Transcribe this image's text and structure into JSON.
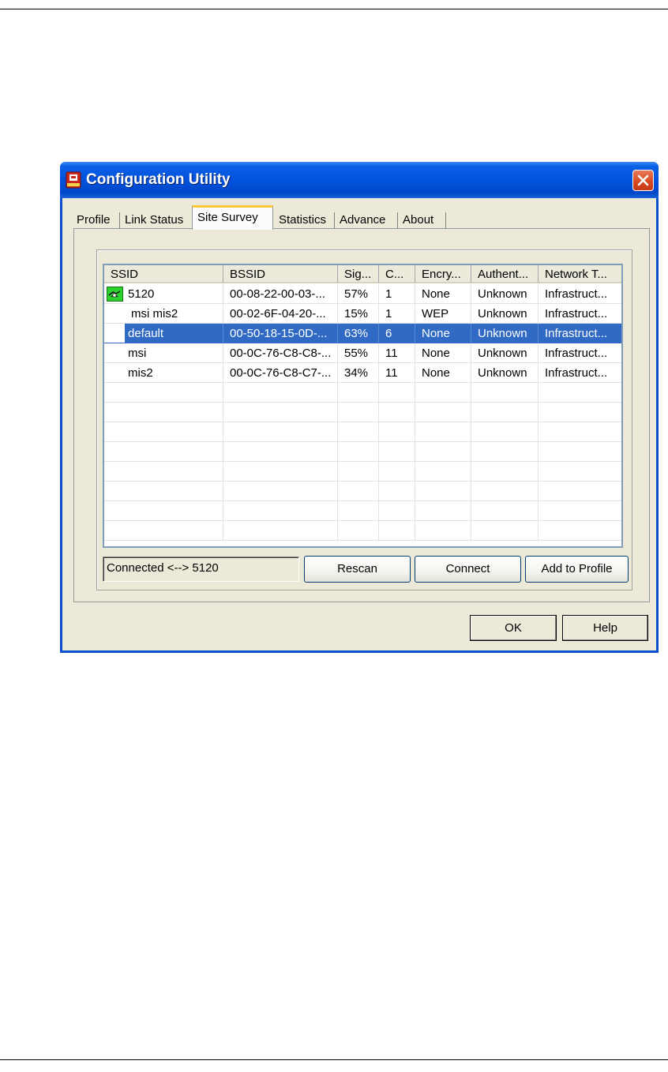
{
  "window": {
    "title": "Configuration Utility"
  },
  "tabs": [
    {
      "label": "Profile"
    },
    {
      "label": "Link Status"
    },
    {
      "label": "Site Survey"
    },
    {
      "label": "Statistics"
    },
    {
      "label": "Advance"
    },
    {
      "label": "About"
    }
  ],
  "active_tab": "Site Survey",
  "site_survey": {
    "columns": [
      "SSID",
      "BSSID",
      "Sig...",
      "C...",
      "Encry...",
      "Authent...",
      "Network T..."
    ],
    "rows": [
      {
        "ssid": "5120",
        "bssid": "00-08-22-00-03-...",
        "signal": "57%",
        "channel": "1",
        "encryption": "None",
        "auth": "Unknown",
        "network_type": "Infrastruct...",
        "connected": true
      },
      {
        "ssid": "msi mis2",
        "bssid": "00-02-6F-04-20-...",
        "signal": "15%",
        "channel": "1",
        "encryption": "WEP",
        "auth": "Unknown",
        "network_type": "Infrastruct..."
      },
      {
        "ssid": "default",
        "bssid": "00-50-18-15-0D-...",
        "signal": "63%",
        "channel": "6",
        "encryption": "None",
        "auth": "Unknown",
        "network_type": "Infrastruct...",
        "selected": true
      },
      {
        "ssid": "msi",
        "bssid": "00-0C-76-C8-C8-...",
        "signal": "55%",
        "channel": "11",
        "encryption": "None",
        "auth": "Unknown",
        "network_type": "Infrastruct..."
      },
      {
        "ssid": "mis2",
        "bssid": "00-0C-76-C8-C7-...",
        "signal": "34%",
        "channel": "11",
        "encryption": "None",
        "auth": "Unknown",
        "network_type": "Infrastruct..."
      }
    ],
    "status_text": "Connected <--> 5120",
    "rescan_label": "Rescan",
    "connect_label": "Connect",
    "add_profile_label": "Add to Profile"
  },
  "dialog": {
    "ok_label": "OK",
    "help_label": "Help"
  },
  "icons": {
    "app": "network-adapter-icon",
    "close": "close-icon",
    "connected": "connected-handshake-icon"
  },
  "colors": {
    "title_bar": "#0352dd",
    "selection": "#316ac5",
    "close_button": "#d6471f",
    "active_tab_accent": "#ffc83c"
  }
}
